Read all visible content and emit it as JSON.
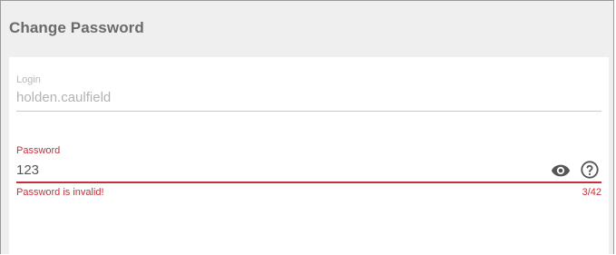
{
  "dialog": {
    "title": "Change Password"
  },
  "login": {
    "label": "Login",
    "value": "holden.caulfield"
  },
  "password": {
    "label": "Password",
    "value": "123",
    "error": "Password is invalid!",
    "counter": "3/42",
    "visibility_icon": "eye-icon",
    "help_icon": "help-circle-icon"
  },
  "colors": {
    "error": "#c7303a",
    "header_bg": "#efefef",
    "title_text": "#6a6a6a",
    "muted_text": "#b3b3b3"
  }
}
